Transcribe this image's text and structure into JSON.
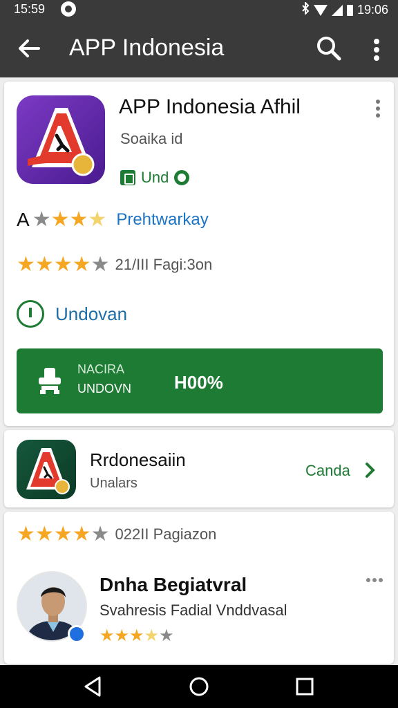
{
  "status_bar": {
    "time_left": "15:59",
    "time_right": "19:06"
  },
  "app_bar": {
    "title": "APP Indonesia"
  },
  "app": {
    "title": "APP Indonesia Afhil",
    "developer": "Soaika id",
    "badge_label": "Und",
    "rating_lead": "A",
    "rating_link": "Prehtwarkay",
    "rating_count": "21/III Fagi:3on",
    "download_label": "Undovan",
    "install": {
      "line1": "NACIRA",
      "line2": "UNDOVN",
      "percent": "H00%"
    }
  },
  "related": {
    "title": "Rrdonesaiin",
    "subtitle": "Unalars",
    "action": "Canda"
  },
  "review": {
    "count": "022II Pagiazon",
    "name": "Dnha Begiatvral",
    "subtitle": "Svahresis Fadial Vnddvasal"
  },
  "ratings": {
    "row1": 3.5,
    "row2": 4,
    "row3": 4,
    "reviewer": 3.5
  },
  "colors": {
    "bar": "#3a3a3a",
    "green": "#1e7b34",
    "link": "#1b74c4",
    "star": "#f5a623"
  },
  "icons": [
    "back-arrow-icon",
    "search-icon",
    "more-vert-icon",
    "nav-back-icon",
    "nav-home-icon",
    "nav-recents-icon"
  ]
}
